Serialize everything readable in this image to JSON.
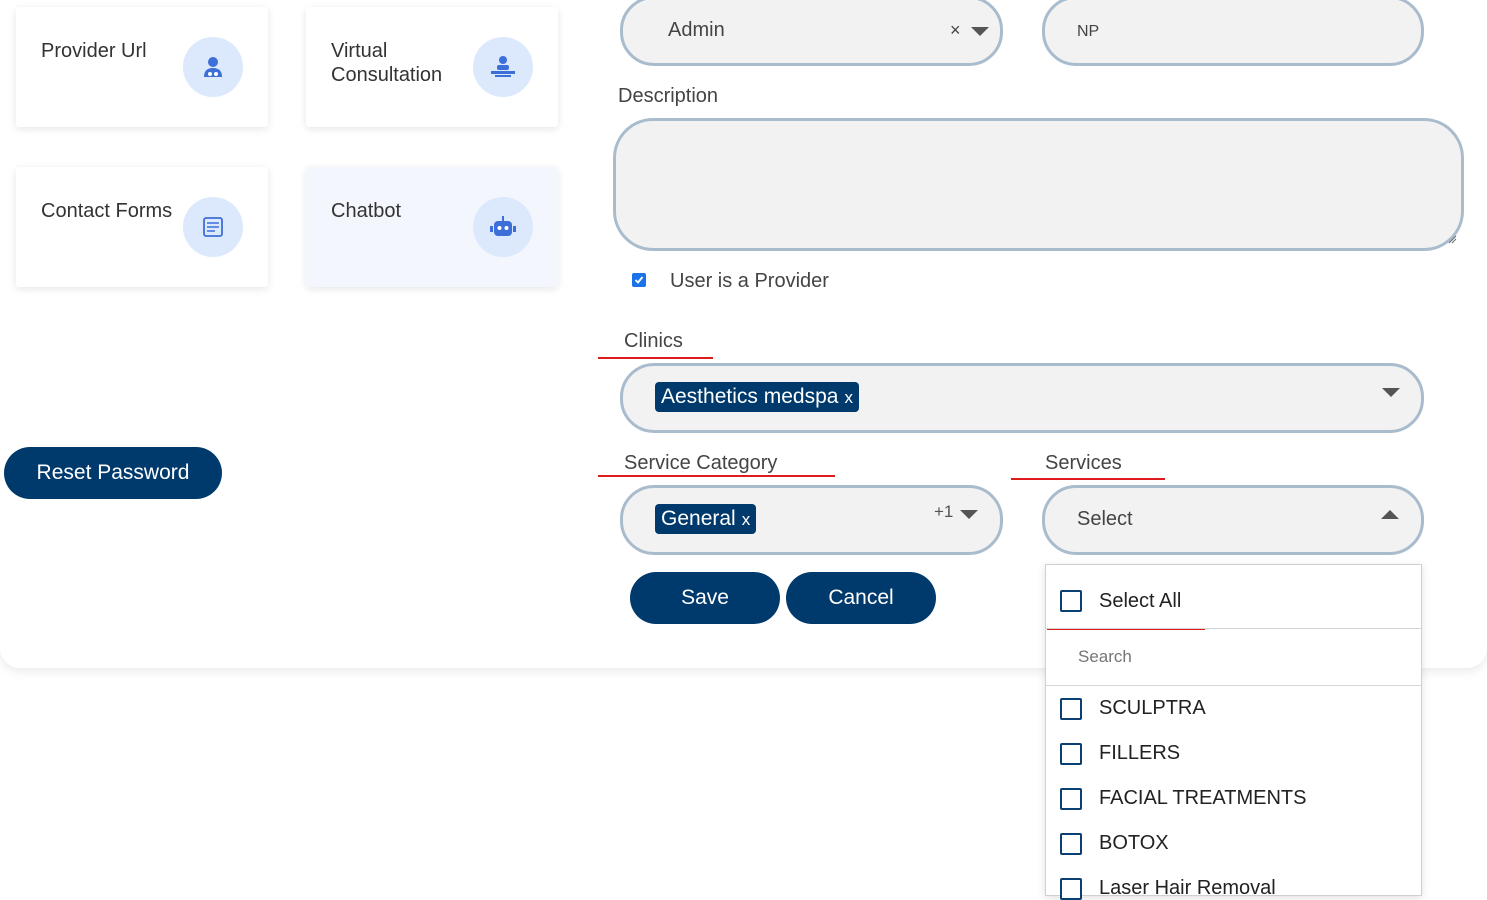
{
  "cards": [
    {
      "label": "Provider Url",
      "icon": "provider-icon"
    },
    {
      "label": "Virtual Consultation",
      "icon": "consultation-icon"
    },
    {
      "label": "Contact Forms",
      "icon": "form-icon"
    },
    {
      "label": "Chatbot",
      "icon": "robot-icon"
    }
  ],
  "reset_password_label": "Reset Password",
  "role": {
    "value": "Admin",
    "clear": "×"
  },
  "title_field": {
    "value": "NP"
  },
  "description": {
    "label": "Description",
    "value": ""
  },
  "provider_checkbox": {
    "label": "User is a Provider",
    "checked": true
  },
  "clinics": {
    "label": "Clinics",
    "tag": "Aesthetics medspa",
    "tag_remove": "x"
  },
  "service_category": {
    "label": "Service Category",
    "tag": "General",
    "tag_remove": "x",
    "more": "+1"
  },
  "services": {
    "label": "Services",
    "placeholder": "Select",
    "select_all": "Select All",
    "search_placeholder": "Search",
    "options": [
      "SCULPTRA",
      "FILLERS",
      "FACIAL TREATMENTS",
      "BOTOX",
      "Laser Hair Removal"
    ]
  },
  "actions": {
    "save": "Save",
    "cancel": "Cancel"
  },
  "colors": {
    "primary": "#003a6c",
    "annotation": "#e01b1b",
    "field_border": "#a9bccd"
  }
}
